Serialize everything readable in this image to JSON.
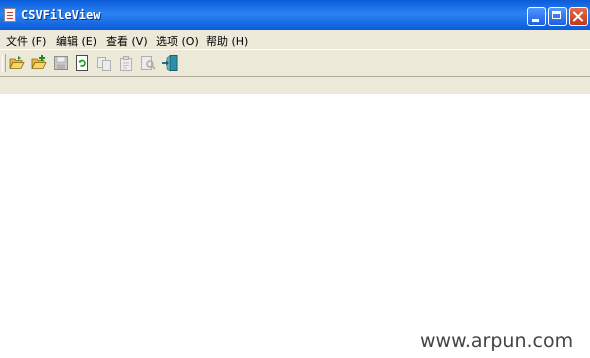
{
  "window": {
    "title": "CSVFileView"
  },
  "menubar": {
    "items": [
      {
        "label": "文件 (F)"
      },
      {
        "label": "编辑 (E)"
      },
      {
        "label": "查看 (V)"
      },
      {
        "label": "选项 (O)"
      },
      {
        "label": "帮助 (H)"
      }
    ]
  },
  "toolbar": {
    "buttons": [
      {
        "icon": "open-folder-icon",
        "enabled": true
      },
      {
        "icon": "open-folder-add-icon",
        "enabled": true
      },
      {
        "icon": "save-icon",
        "enabled": false
      },
      {
        "icon": "refresh-icon",
        "enabled": true
      },
      {
        "icon": "copy-icon",
        "enabled": false
      },
      {
        "icon": "properties-icon",
        "enabled": false
      },
      {
        "icon": "find-icon",
        "enabled": false
      },
      {
        "icon": "exit-icon",
        "enabled": true
      }
    ]
  },
  "watermark": "www.arpun.com"
}
